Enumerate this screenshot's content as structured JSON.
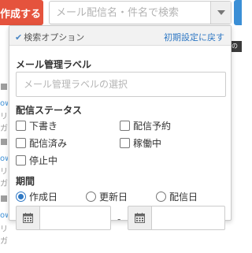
{
  "toolbar": {
    "create_label": "作成する",
    "search_placeholder": "メール配信名・件名で検索"
  },
  "background": {
    "dark_strip_text": "のみ",
    "row_links": [
      "ow",
      "ow",
      "ow"
    ],
    "row_gray": [
      "リガ",
      "リガ",
      "リガ"
    ]
  },
  "search_options": {
    "title": "検索オプション",
    "reset_label": "初期設定に戻す",
    "label_section": {
      "title": "メール管理ラベル",
      "placeholder": "メール管理ラベルの選択"
    },
    "status_section": {
      "title": "配信ステータス",
      "options": [
        "下書き",
        "配信予約",
        "配信済み",
        "稼働中",
        "停止中"
      ]
    },
    "period_section": {
      "title": "期間",
      "options": [
        "作成日",
        "更新日",
        "配信日"
      ],
      "selected": "作成日",
      "range_separator": "-"
    }
  },
  "colors": {
    "create_button": "#e5533d",
    "accent_blue": "#2f78c4",
    "right_button": "#3b8fd6"
  }
}
